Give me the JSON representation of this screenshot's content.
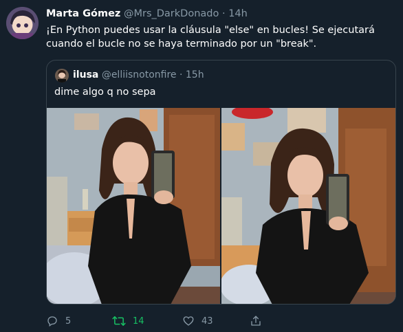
{
  "tweet": {
    "display_name": "Marta Gómez",
    "handle": "@Mrs_DarkDonado",
    "separator": "·",
    "time": "14h",
    "text": "¡En Python puedes usar la cláusula \"else\" en bucles! Se ejecutará cuando el bucle no se haya terminado por un \"break\"."
  },
  "quoted": {
    "display_name": "ilusa",
    "handle": "@elliisnotonfire",
    "separator": "·",
    "time": "15h",
    "text": "dime algo q no sepa"
  },
  "actions": {
    "replies": "5",
    "retweets": "14",
    "likes": "43"
  },
  "colors": {
    "background": "#15202b",
    "secondary_text": "#8899a6",
    "retweet_active": "#17bf63",
    "border": "#38444d"
  },
  "icons": [
    "reply-icon",
    "retweet-icon",
    "like-icon",
    "share-icon"
  ]
}
